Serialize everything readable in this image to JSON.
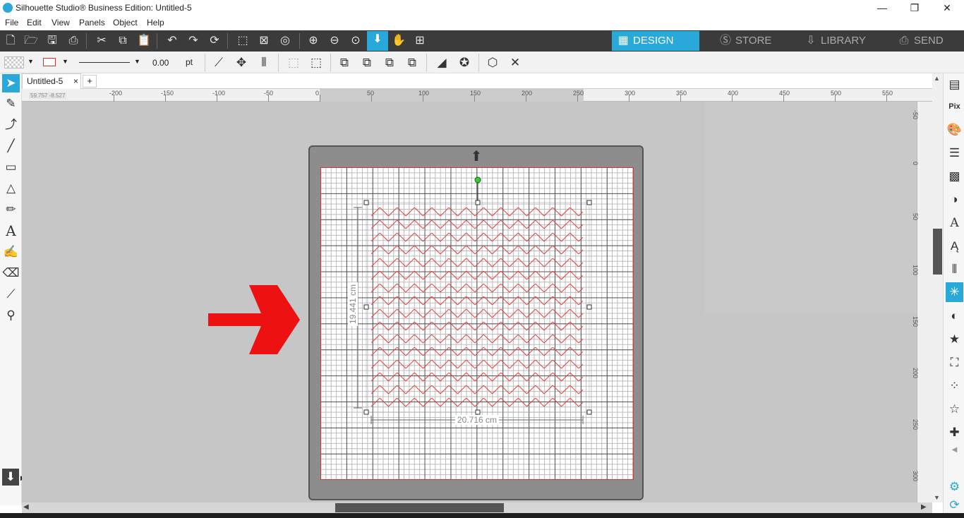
{
  "app": {
    "title": "Silhouette Studio® Business Edition: Untitled-5"
  },
  "window_controls": {
    "minimize": "—",
    "maximize": "❐",
    "close": "✕"
  },
  "menu": [
    "File",
    "Edit",
    "View",
    "Panels",
    "Object",
    "Help"
  ],
  "nav_tabs": [
    {
      "label": "DESIGN",
      "icon": "design-grid-icon",
      "active": true
    },
    {
      "label": "STORE",
      "icon": "store-s-icon",
      "active": false
    },
    {
      "label": "LIBRARY",
      "icon": "library-download-icon",
      "active": false
    },
    {
      "label": "SEND",
      "icon": "send-cutter-icon",
      "active": false
    }
  ],
  "line_props": {
    "width_value": "0.00",
    "unit": "pt"
  },
  "document": {
    "tab_name": "Untitled-5",
    "close_glyph": "×",
    "add_tab_glyph": "+"
  },
  "coordinate_readout": {
    "x": "59.757",
    "y": "-8.527"
  },
  "ruler_h": [
    "-200",
    "-150",
    "-100",
    "-50",
    "0",
    "50",
    "100",
    "150",
    "200",
    "250",
    "300",
    "350",
    "400",
    "450",
    "500",
    "550"
  ],
  "ruler_v": [
    "-50",
    "0",
    "50",
    "100",
    "150",
    "200",
    "250",
    "300"
  ],
  "selection": {
    "width": "20.716 cm",
    "height": "19.441 cm"
  },
  "colors": {
    "accent": "#29a9d9",
    "arrow": "#ee1111",
    "cut_lines": "#e04040",
    "toolbar_dark": "#3b3b3b"
  }
}
